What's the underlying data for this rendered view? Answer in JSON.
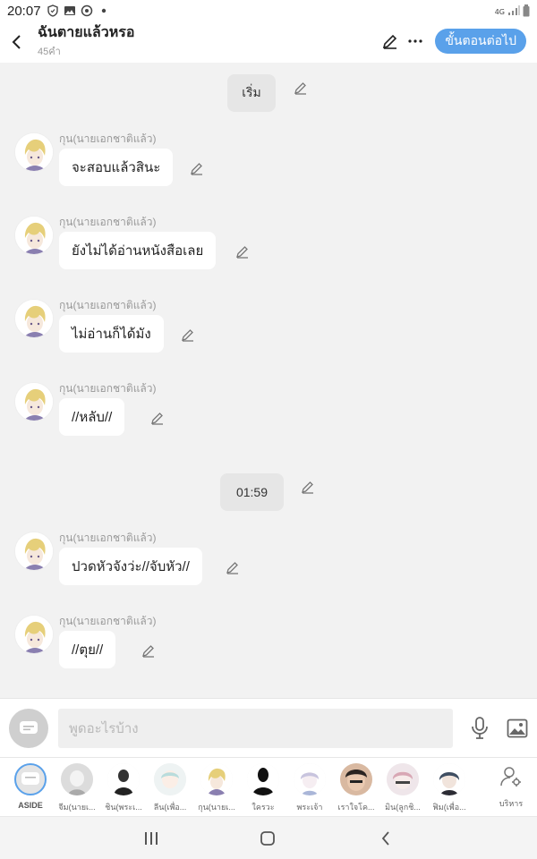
{
  "status_bar": {
    "time": "20:07",
    "network": "4G"
  },
  "header": {
    "back_label": "<",
    "title": "ฉันตายแล้วหรอ",
    "subtitle": "45คำ",
    "next_label": "ขั้นตอนต่อไป"
  },
  "chat": {
    "start_label": "เริ่ม",
    "time_label": "01:59",
    "messages": [
      {
        "sender": "กุน(นายเอกชาติแล้ว)",
        "text": "จะสอบแล้วสินะ"
      },
      {
        "sender": "กุน(นายเอกชาติแล้ว)",
        "text": "ยังไม่ได้อ่านหนังสือเลย"
      },
      {
        "sender": "กุน(นายเอกชาติแล้ว)",
        "text": "ไม่อ่านก็ได้มัง"
      },
      {
        "sender": "กุน(นายเอกชาติแล้ว)",
        "text": "//หลับ//"
      },
      {
        "sender": "กุน(นายเอกชาติแล้ว)",
        "text": "ปวดหัวจังว่ะ//จับหัว//"
      },
      {
        "sender": "กุน(นายเอกชาติแล้ว)",
        "text": "//ตุย//"
      }
    ]
  },
  "input": {
    "placeholder": "พูดอะไรบ้าง"
  },
  "characters": [
    {
      "name": "ASIDE"
    },
    {
      "name": "จีม(นายเ..."
    },
    {
      "name": "ชิน(พระเ..."
    },
    {
      "name": "ลีน(เพื่อ..."
    },
    {
      "name": "กุน(นายเ..."
    },
    {
      "name": "ใครวะ"
    },
    {
      "name": "พระเจ้า"
    },
    {
      "name": "เราใจโค..."
    },
    {
      "name": "มิน(ลูกชิ..."
    },
    {
      "name": "ฟิม(เพื่อ..."
    }
  ],
  "manage_label": "บริหาร",
  "colors": {
    "accent": "#5aa1ea",
    "bubble": "#ffffff",
    "background": "#f2f2f2"
  }
}
